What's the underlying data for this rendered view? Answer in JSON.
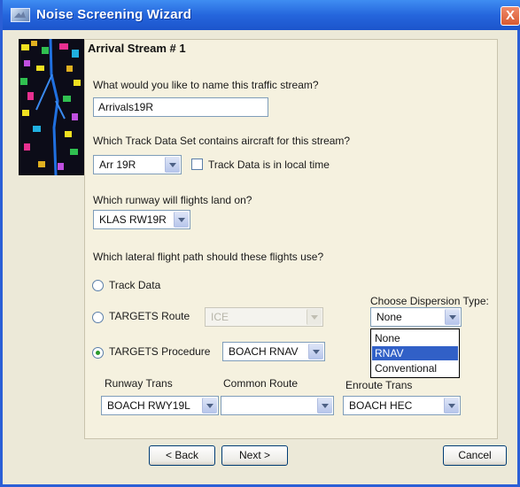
{
  "window": {
    "title": "Noise Screening Wizard",
    "close_glyph": "X"
  },
  "page": {
    "heading": "Arrival Stream # 1"
  },
  "stream_name": {
    "question": "What would you like to name this traffic stream?",
    "value": "Arrivals19R"
  },
  "track_data_set": {
    "question": "Which Track Data Set contains aircraft for this stream?",
    "selected": "Arr 19R",
    "local_time_label": "Track Data is in local time",
    "local_time_checked": false
  },
  "runway": {
    "question": "Which runway will flights land on?",
    "selected": "KLAS RW19R"
  },
  "lateral_path": {
    "question": "Which lateral flight path should these flights use?",
    "options": [
      {
        "label": "Track Data",
        "selected": false
      },
      {
        "label": "TARGETS Route",
        "selected": false,
        "combo_value": "ICE"
      },
      {
        "label": "TARGETS Procedure",
        "selected": true,
        "combo_value": "BOACH RNAV"
      }
    ]
  },
  "dispersion": {
    "label": "Choose Dispersion Type:",
    "selected": "None",
    "list_options": [
      "None",
      "RNAV",
      "Conventional"
    ],
    "highlighted": "RNAV"
  },
  "procedure_parts": {
    "runway_trans_label": "Runway Trans",
    "runway_trans_value": "BOACH RWY19L",
    "common_route_label": "Common Route",
    "common_route_value": "",
    "enroute_trans_label": "Enroute Trans",
    "enroute_trans_value": "BOACH HEC"
  },
  "buttons": {
    "back": "< Back",
    "next": "Next >",
    "cancel": "Cancel"
  },
  "colors": {
    "titlebar": "#2566dd",
    "selection": "#3160c7",
    "panel": "#f5f1df"
  }
}
